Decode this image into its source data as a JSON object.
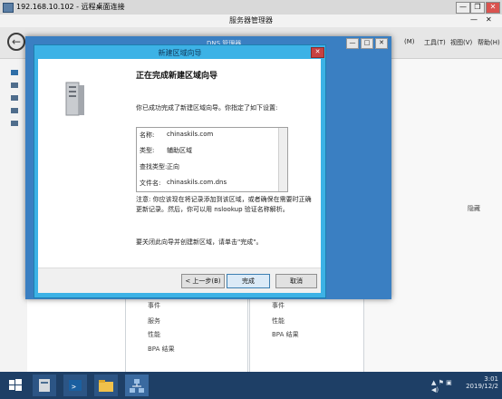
{
  "rdp": {
    "title": "192.168.10.102 - 远程桌面连接",
    "minimize": "—",
    "restore": "❐",
    "close": "✕"
  },
  "server_manager": {
    "title": "服务器管理器",
    "back_glyph": "←",
    "menus": [
      "(M)",
      "工具(T)",
      "视图(V)",
      "帮助(H)"
    ],
    "right_panel_label": "隐藏",
    "tiles": [
      {
        "items": [
          "事件",
          "服务",
          "性能",
          "BPA 结果"
        ]
      },
      {
        "items": [
          "事件",
          "性能",
          "BPA 结果"
        ]
      }
    ]
  },
  "dns_window": {
    "title": "DNS 管理器",
    "min": "—",
    "max": "□",
    "close": "✕"
  },
  "wizard": {
    "title": "新建区域向导",
    "close": "✕",
    "heading": "正在完成新建区域向导",
    "intro": "你已成功完成了新建区域向导。你指定了如下设置:",
    "summary": [
      {
        "label": "名称:",
        "value": "chinaskils.com"
      },
      {
        "label": "类型:",
        "value": "辅助区域"
      },
      {
        "label": "查找类型:",
        "value": "正向"
      },
      {
        "label": "文件名:",
        "value": "chinaskils.com.dns"
      }
    ],
    "note": "注意: 你应该现在将记录添加到该区域，或者确保在需要时正确更新记录。然后，你可以用 nslookup 验证名称解析。",
    "close_hint": "要关闭此向导并创建新区域，请单击\"完成\"。",
    "buttons": {
      "back": "< 上一步(B)",
      "finish": "完成",
      "cancel": "取消"
    }
  },
  "taskbar": {
    "time": "3:01",
    "date": "2019/12/2"
  }
}
